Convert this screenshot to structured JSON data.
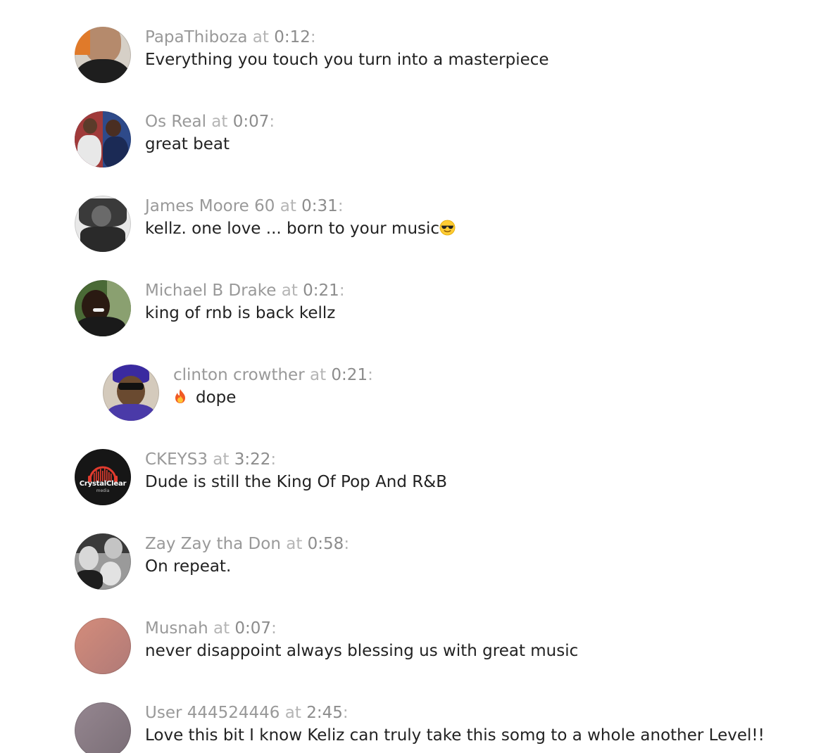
{
  "comments": [
    {
      "user": "PapaThiboza",
      "at": "at",
      "time": "0:12",
      "text": "Everything you touch you turn into a masterpiece",
      "avatar_color": "#d8d3cc"
    },
    {
      "user": "Os Real",
      "at": "at",
      "time": "0:07",
      "text": "great beat",
      "avatar_color": "#6a5a7a"
    },
    {
      "user": "James Moore 60",
      "at": "at",
      "time": "0:31",
      "text": "kellz. one love ... born to your music",
      "emoji": "smiling-face-with-sunglasses-icon",
      "avatar_color": "#5a5a5a"
    },
    {
      "user": "Michael B Drake",
      "at": "at",
      "time": "0:21",
      "text": "king of rnb is back kellz",
      "avatar_color": "#3c4a30"
    },
    {
      "user": "clinton crowther",
      "at": "at",
      "time": "0:21",
      "text": "dope",
      "emoji": "fire-icon",
      "reply": true,
      "avatar_color": "#cfc6b8"
    },
    {
      "user": "CKEYS3",
      "at": "at",
      "time": "3:22",
      "text": "Dude is still the King Of Pop And R&B",
      "avatar_logo_text": "CrystalClear",
      "avatar_logo_sub": "media",
      "avatar_color": "#1a1a1a",
      "accent": "#e23b2e"
    },
    {
      "user": "Zay Zay tha Don",
      "at": "at",
      "time": "0:58",
      "text": "On repeat.",
      "avatar_color": "#8a8a8a"
    },
    {
      "user": "Musnah",
      "at": "at",
      "time": "0:07",
      "text": "never disappoint always blessing us with great music",
      "avatar_color": "#c98a7c"
    },
    {
      "user": "User 444524446",
      "at": "at",
      "time": "2:45",
      "text": "Love this bit I know Keliz can truly take this somg to a whole another Level!!",
      "avatar_color": "#8c7d85"
    }
  ],
  "colors": {
    "username": "#999999",
    "at": "#b5b5b5",
    "time": "#8c8c8c",
    "text": "#222222",
    "background": "#ffffff"
  }
}
